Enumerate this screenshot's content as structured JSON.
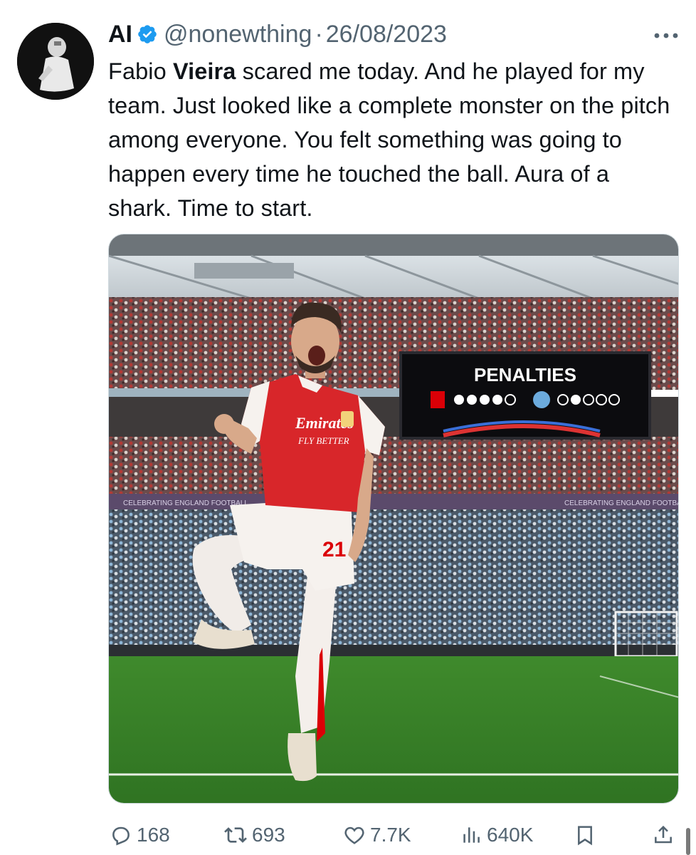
{
  "tweet": {
    "author": {
      "display_name": "AI",
      "handle": "@nonewthing",
      "verified": true
    },
    "separator": "·",
    "date": "26/08/2023",
    "text_parts": [
      "Fabio ",
      "Vieira",
      " scared me today. And he played for my team. Just looked like a complete monster on the pitch among everyone. You felt something was going to happen every time he touched the ball. Aura of a shark. Time to start."
    ]
  },
  "media": {
    "scoreboard_title": "PENALTIES",
    "jersey_sponsor": "Emirates",
    "jersey_tagline": "FLY BETTER",
    "shorts_number": "21"
  },
  "actions": {
    "replies": "168",
    "retweets": "693",
    "likes": "7.7K",
    "views": "640K"
  },
  "icons": {
    "verified": "verified-badge-icon",
    "more": "more-options-icon",
    "reply": "reply-icon",
    "retweet": "retweet-icon",
    "like": "heart-icon",
    "views": "views-chart-icon",
    "bookmark": "bookmark-icon",
    "share": "share-icon"
  },
  "colors": {
    "text": "#0f1419",
    "secondary": "#536471",
    "verified_blue": "#1d9bf0",
    "arsenal_red": "#db0007"
  }
}
